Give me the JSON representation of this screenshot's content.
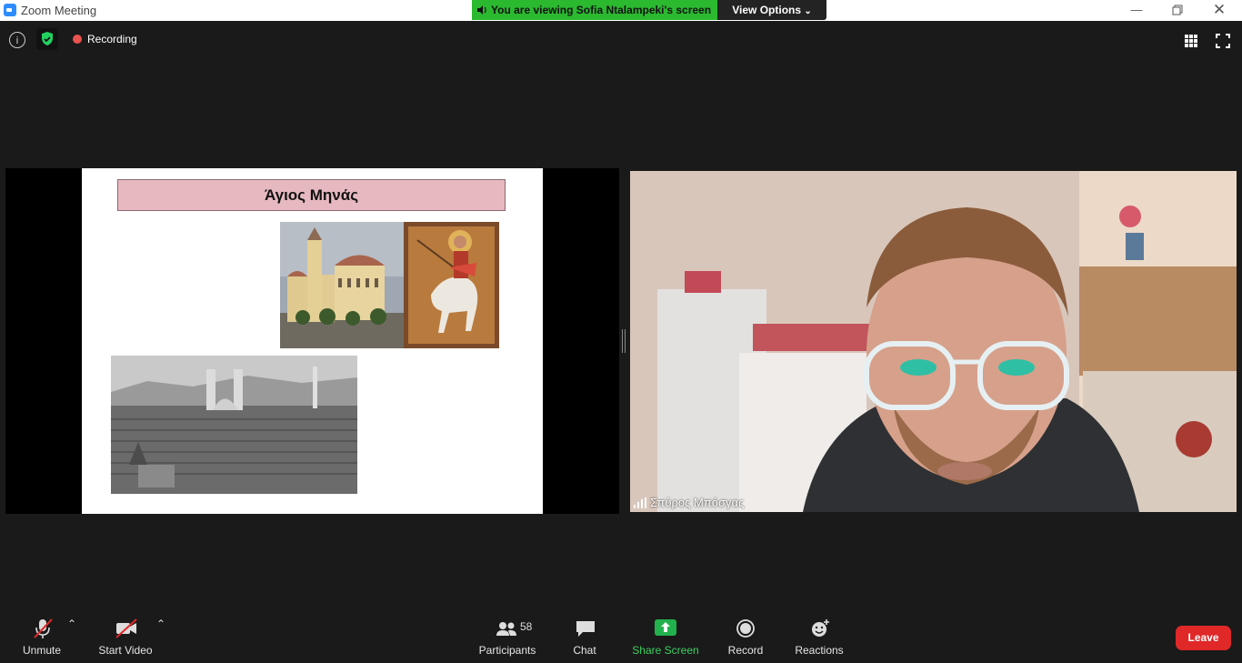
{
  "window": {
    "title": "Zoom Meeting",
    "minimize_icon": "minimize-icon",
    "restore_icon": "restore-icon",
    "close_icon": "close-icon"
  },
  "banner": {
    "viewing_text": "You are viewing Sofia Ntalampeki's screen",
    "view_options_label": "View Options",
    "banner_color": "#2bb930"
  },
  "topbar": {
    "recording_label": "Recording",
    "info_icon": "info-icon",
    "security_icon": "shield-icon",
    "grid_icon": "gallery-grid-icon",
    "fullscreen_icon": "fullscreen-icon"
  },
  "slide": {
    "title": "Άγιος Μηνάς",
    "title_bg": "#e6b8bf",
    "images": [
      "church-photo",
      "saint-icon-painting",
      "old-city-photo"
    ]
  },
  "video": {
    "participant_name": "Σπύρος Μπόσγας"
  },
  "toolbar": {
    "unmute_label": "Unmute",
    "start_video_label": "Start Video",
    "participants_label": "Participants",
    "participants_count": "58",
    "chat_label": "Chat",
    "share_screen_label": "Share Screen",
    "record_label": "Record",
    "reactions_label": "Reactions",
    "leave_label": "Leave",
    "share_color": "#22b14c",
    "leave_color": "#e02828"
  }
}
